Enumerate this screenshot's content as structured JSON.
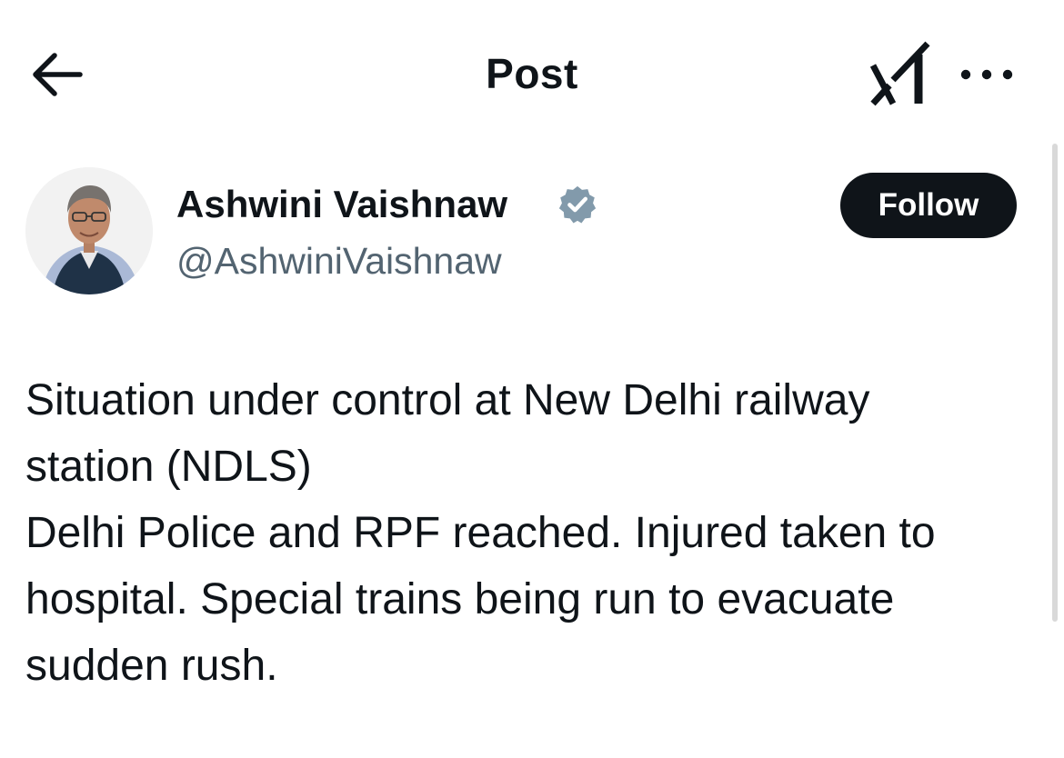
{
  "header": {
    "title": "Post",
    "back_icon": "arrow-left-icon",
    "grok_icon": "grok-icon",
    "more_icon": "more-horizontal-icon"
  },
  "author": {
    "display_name": "Ashwini Vaishnaw",
    "handle": "@AshwiniVaishnaw",
    "verified_icon": "verified-badge-icon",
    "verified_color": "#829aab"
  },
  "follow_button": {
    "label": "Follow",
    "background": "#0f1419",
    "text_color": "#ffffff"
  },
  "post": {
    "lines": [
      "Situation under control at New Delhi railway",
      "station (NDLS)",
      "Delhi Police and RPF reached. Injured taken to",
      "hospital. Special trains being run to evacuate",
      "sudden rush."
    ]
  },
  "colors": {
    "text_primary": "#0f1419",
    "text_secondary": "#536471"
  }
}
